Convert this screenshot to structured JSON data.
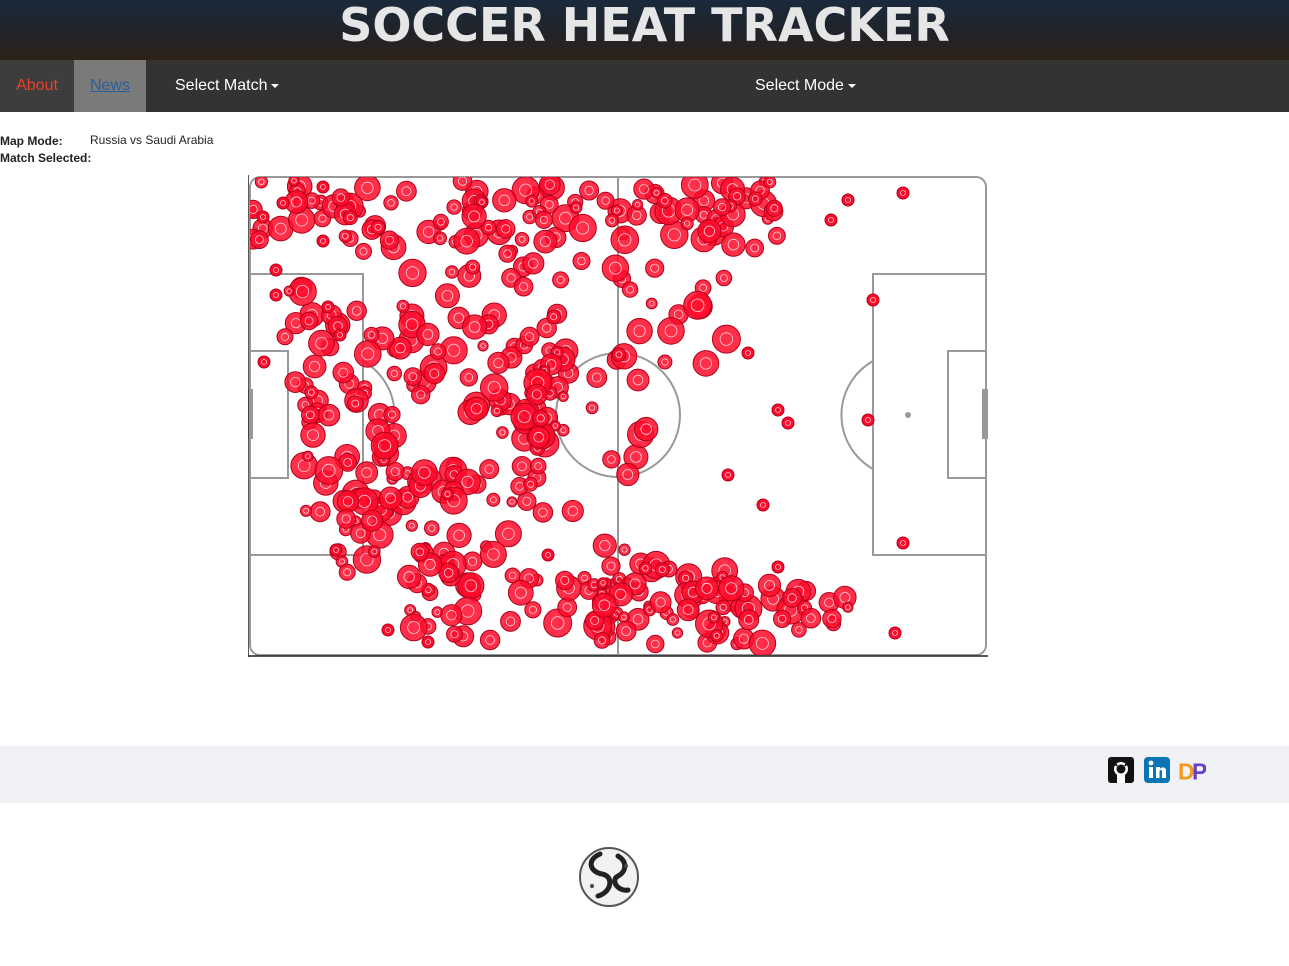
{
  "header": {
    "title": "SOCCER HEAT TRACKER"
  },
  "nav": {
    "about": "About",
    "news": "News",
    "select_match": "Select Match",
    "select_mode": "Select Mode"
  },
  "info": {
    "map_mode_label": "Map Mode:",
    "map_mode_value": "Russia vs Saudi Arabia",
    "match_selected_label": "Match Selected:"
  },
  "heatmap": {
    "color": "#ff0a2a",
    "contour_color": "#b0001a",
    "line_color": "#999999"
  },
  "footer": {
    "icons": [
      "github-icon",
      "linkedin-icon",
      "dp-logo-icon"
    ],
    "dp_text": "DP"
  },
  "logo": {
    "icon": "soccer-ball-icon"
  }
}
